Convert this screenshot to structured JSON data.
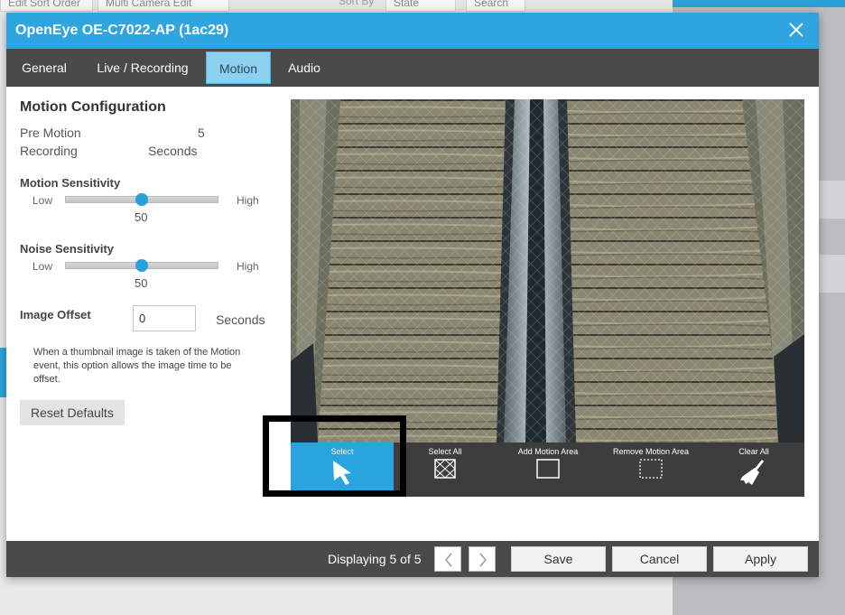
{
  "background": {
    "btn_sort": "Edit Sort Order",
    "btn_multi": "Multi Camera Edit",
    "sort_by_label": "Sort By",
    "sort_by_value": "State",
    "search_label": "Search"
  },
  "modal": {
    "title": "OpenEye OE-C7022-AP (1ac29)",
    "close_icon": "close-icon"
  },
  "tabs": [
    {
      "label": "General"
    },
    {
      "label": "Live / Recording"
    },
    {
      "label": "Motion",
      "active": true
    },
    {
      "label": "Audio"
    }
  ],
  "config": {
    "heading": "Motion Configuration",
    "pre_motion_label_1": "Pre Motion",
    "pre_motion_label_2": "Recording",
    "pre_motion_value": "5",
    "pre_motion_unit": "Seconds",
    "motion_sensitivity": {
      "title": "Motion Sensitivity",
      "low": "Low",
      "high": "High",
      "value": "50",
      "fraction": 0.5
    },
    "noise_sensitivity": {
      "title": "Noise Sensitivity",
      "low": "Low",
      "high": "High",
      "value": "50",
      "fraction": 0.5
    },
    "image_offset": {
      "title": "Image Offset",
      "value": "0",
      "unit": "Seconds"
    },
    "note": "When a thumbnail image is taken of the Motion event, this option allows the image time to be offset.",
    "reset_label": "Reset Defaults"
  },
  "tools": [
    {
      "label": "Select",
      "icon": "arrow-cursor-icon",
      "active": true
    },
    {
      "label": "Select All",
      "icon": "grid-select-icon"
    },
    {
      "label": "Add Motion Area",
      "icon": "square-outline-icon"
    },
    {
      "label": "Remove Motion Area",
      "icon": "dashed-square-icon"
    },
    {
      "label": "Clear All",
      "icon": "broom-icon"
    }
  ],
  "footer": {
    "displaying": "Displaying 5 of 5",
    "prev_icon": "chevron-left-icon",
    "next_icon": "chevron-right-icon",
    "save": "Save",
    "cancel": "Cancel",
    "apply": "Apply"
  },
  "colors": {
    "accent": "#2ea5e0",
    "dark_bar": "#4a4a4b",
    "tool_active": "#28a4e0"
  }
}
